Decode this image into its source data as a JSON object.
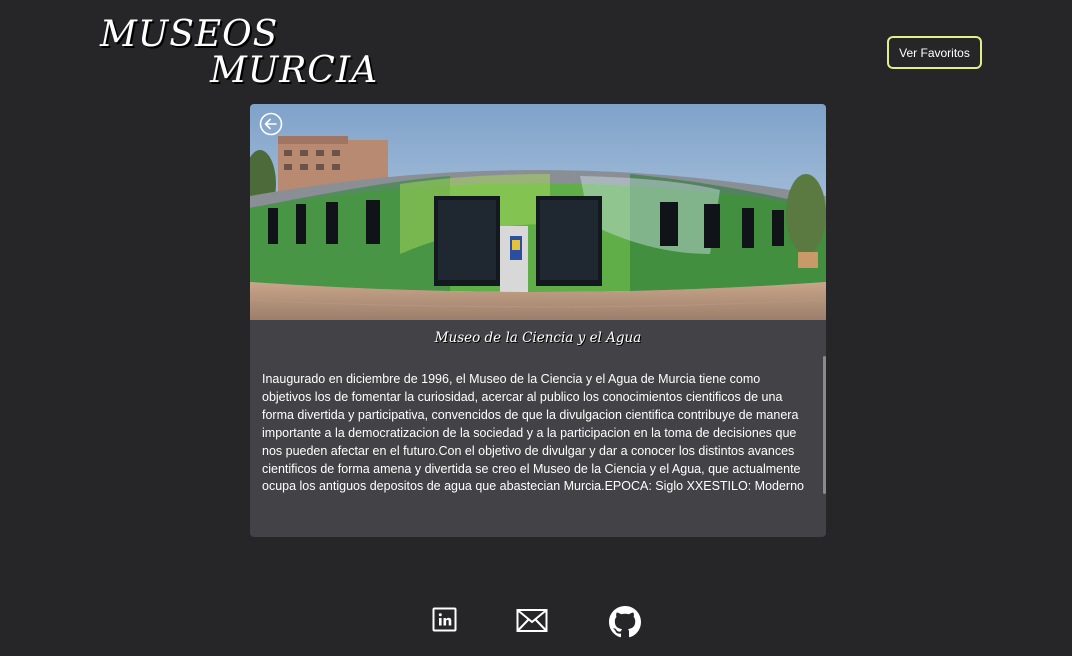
{
  "header": {
    "logo_line1": "MUSEOS",
    "logo_line2": "MURCIA",
    "favorites_button": "Ver Favoritos"
  },
  "museum": {
    "title": "Museo de la Ciencia y el Agua",
    "description": "Inaugurado en diciembre de 1996, el Museo de la Ciencia y el Agua de Murcia tiene como objetivos los de fomentar la curiosidad, acercar al publico los conocimientos cientificos de una forma divertida y participativa, convencidos de que la divulgacion cientifica contribuye de manera importante a la democratizacion de la sociedad y a la participacion en la toma de decisiones que nos pueden afectar en el futuro.Con el objetivo de divulgar y dar a conocer los distintos avances cientificos de forma amena y divertida se creo el Museo de la Ciencia y el Agua, que actualmente ocupa los antiguos depositos de agua que abastecian Murcia.EPOCA: Siglo XXESTILO: Moderno"
  },
  "icons": {
    "back": "arrow-left-circle-icon",
    "footer": [
      "linkedin-icon",
      "mail-icon",
      "github-icon"
    ]
  },
  "colors": {
    "background": "#262628",
    "card": "#424247",
    "button_border": "#e1ee8c"
  }
}
